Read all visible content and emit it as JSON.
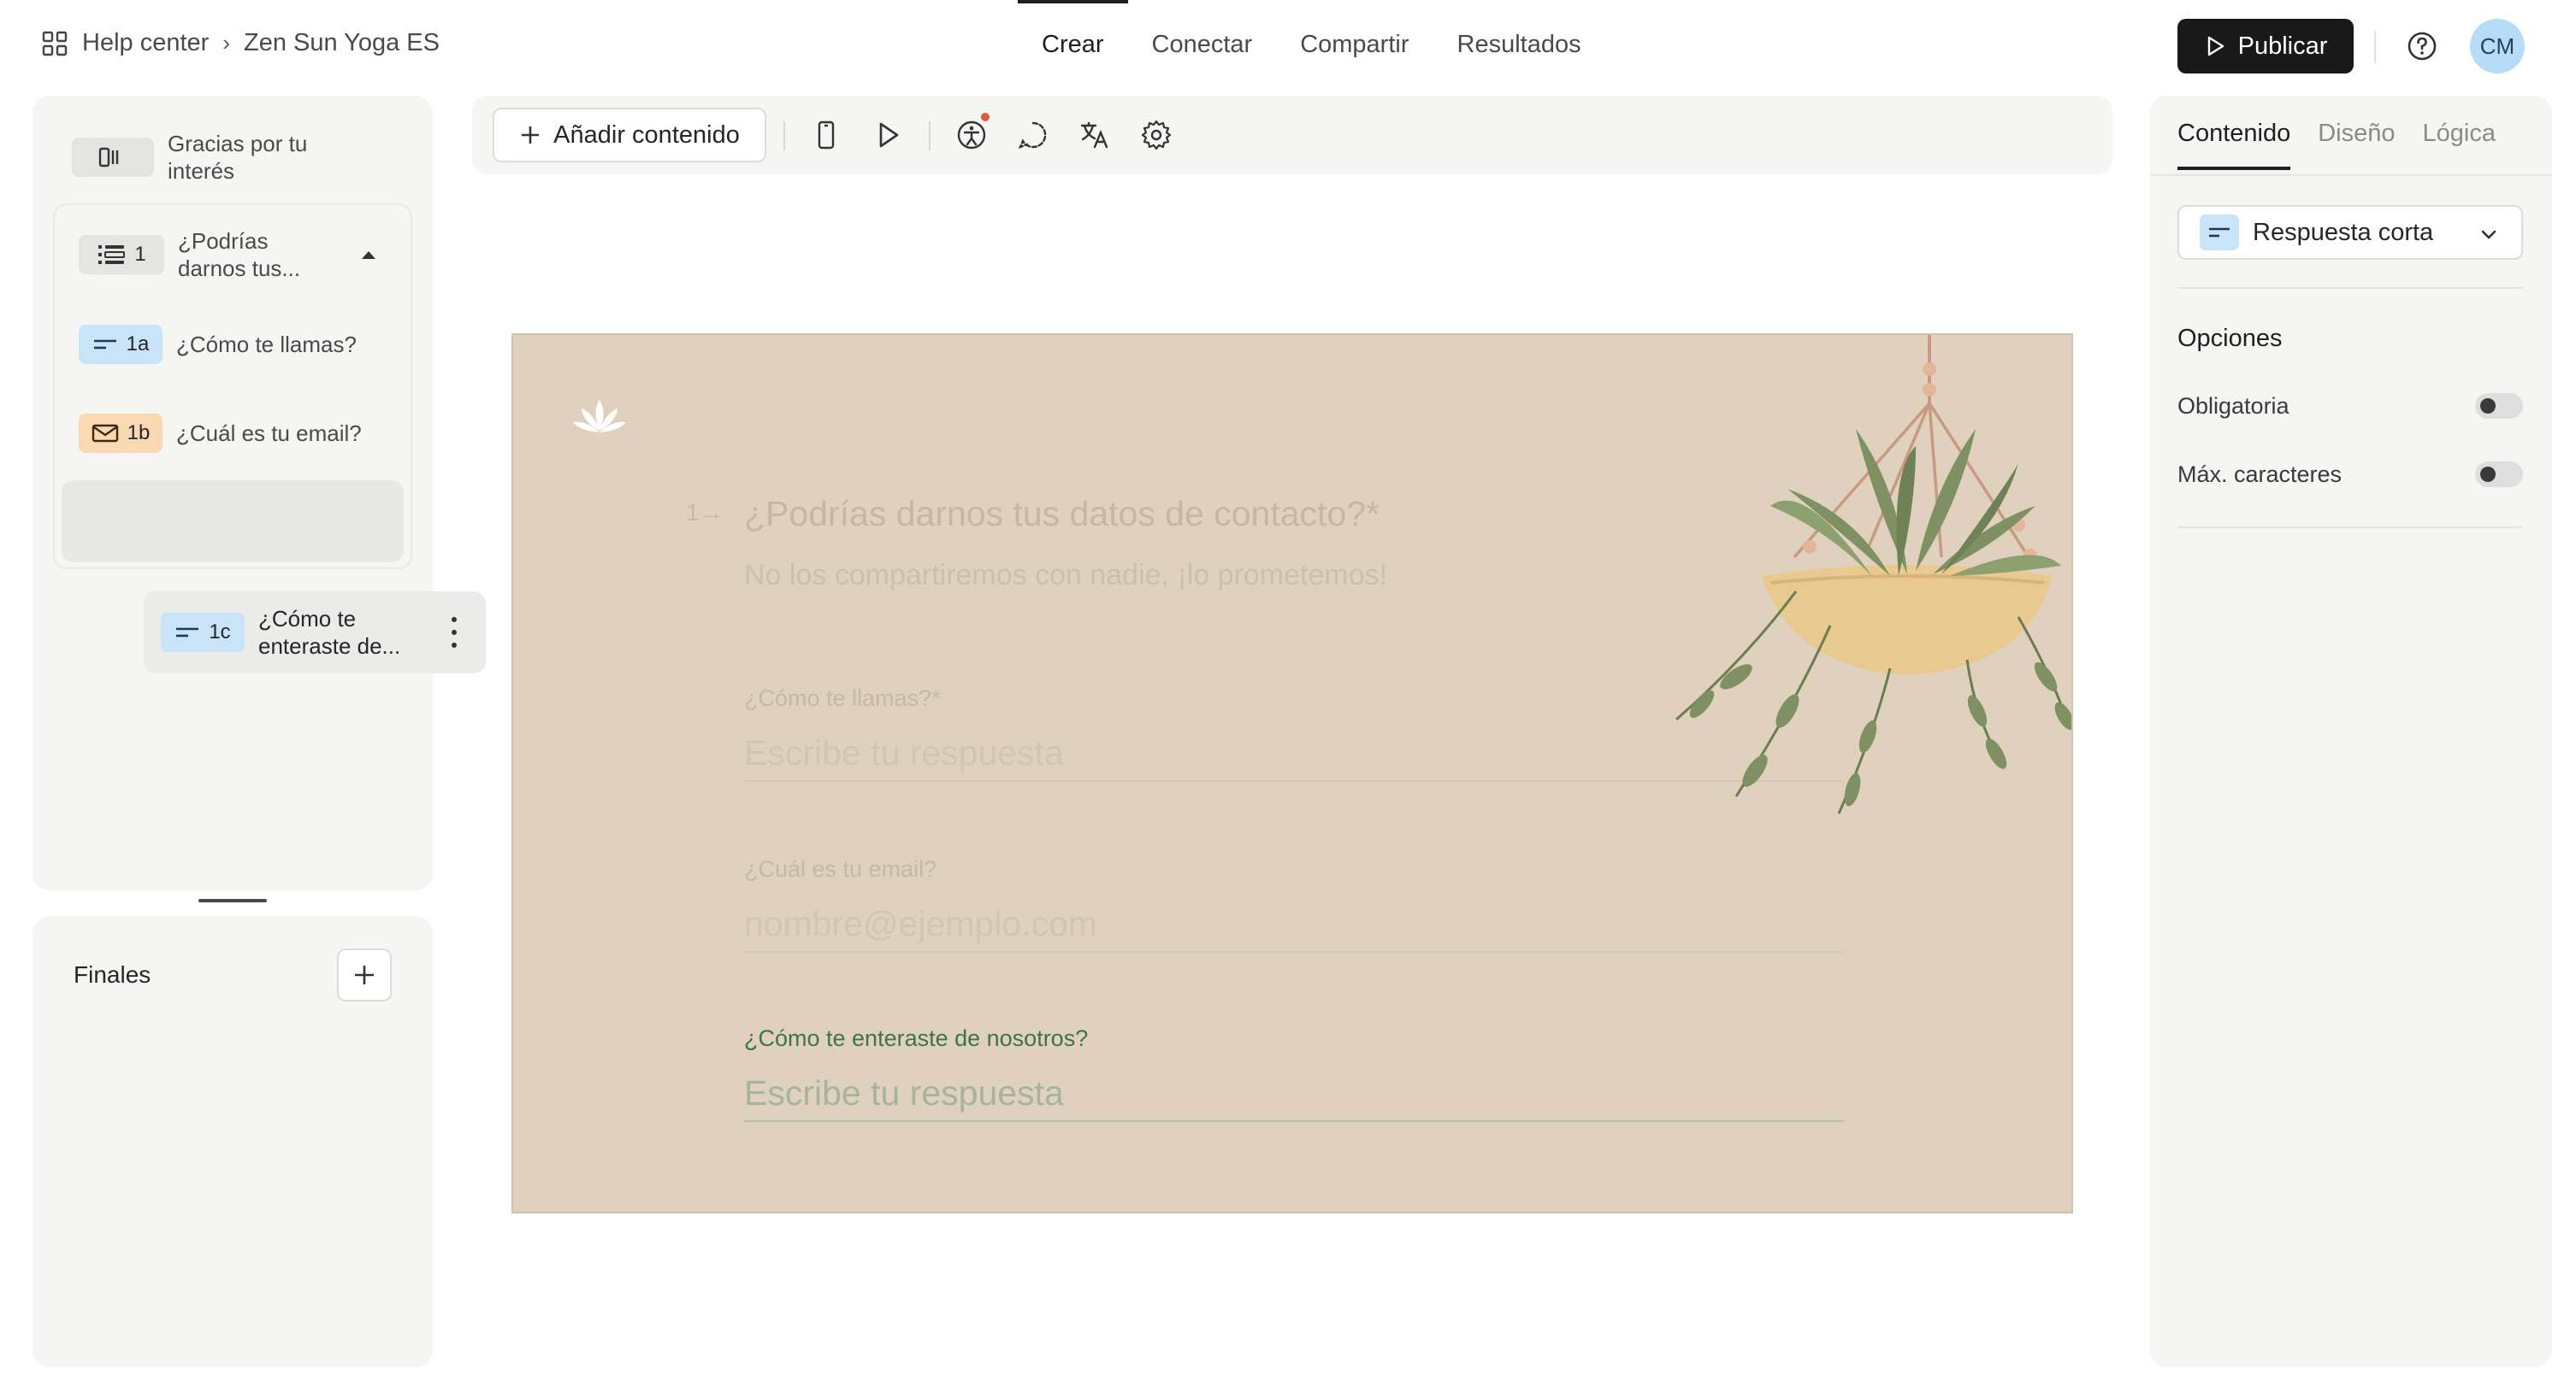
{
  "breadcrumb": {
    "root": "Help center",
    "form": "Zen Sun Yoga ES"
  },
  "nav": {
    "tabs": [
      "Crear",
      "Conectar",
      "Compartir",
      "Resultados"
    ],
    "active": "Crear"
  },
  "header": {
    "publish_label": "Publicar",
    "avatar_initials": "CM"
  },
  "sidebar": {
    "welcome_item": "Gracias por tu interés",
    "group": {
      "number": "1",
      "label": "¿Podrías darnos tus..."
    },
    "items": [
      {
        "number": "1a",
        "label": "¿Cómo te llamas?",
        "icon": "short-text-icon"
      },
      {
        "number": "1b",
        "label": "¿Cuál es tu email?",
        "icon": "mail-icon"
      }
    ],
    "dragging_item": {
      "number": "1c",
      "label": "¿Cómo te enteraste de..."
    },
    "endings_title": "Finales"
  },
  "toolbar": {
    "add_content_label": "Añadir contenido"
  },
  "canvas": {
    "question_number": "1→",
    "question_title": "¿Podrías darnos tus datos de contacto?*",
    "question_subtitle": "No los compartiremos con nadie, ¡lo prometemos!",
    "fields": [
      {
        "label": "¿Cómo te llamas?*",
        "placeholder": "Escribe tu respuesta"
      },
      {
        "label": "¿Cuál es tu email?",
        "placeholder": "nombre@ejemplo.com"
      },
      {
        "label": "¿Cómo te enteraste de nosotros?",
        "placeholder": "Escribe tu respuesta"
      }
    ],
    "colors": {
      "background": "#dfd1bd",
      "active_label": "#3f7446"
    }
  },
  "right_panel": {
    "tabs": [
      "Contenido",
      "Diseño",
      "Lógica"
    ],
    "active_tab": "Contenido",
    "question_type": "Respuesta corta",
    "options_title": "Opciones",
    "options": [
      {
        "label": "Obligatoria",
        "enabled": false
      },
      {
        "label": "Máx. caracteres",
        "enabled": false
      }
    ]
  },
  "colors": {
    "accent_dark": "#191919",
    "avatar_bg": "#b7dcf7",
    "chip_blue": "#c9e3f8",
    "chip_orange": "#fad8b1"
  }
}
